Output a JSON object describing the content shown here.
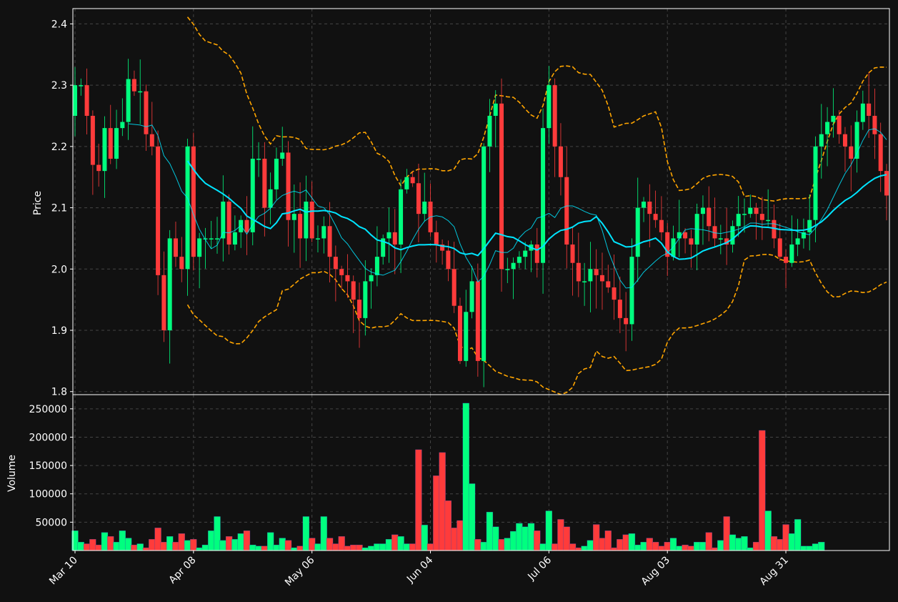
{
  "colors": {
    "background": "#111111",
    "up": "#00ff7f",
    "down": "#ff3b3b",
    "ma_short": "#00e5ff",
    "ma_long": "#00e5ff",
    "bollinger": "#ffa500",
    "grid": "#444444",
    "frame": "#ffffff"
  },
  "chart_data": {
    "type": "candlestick",
    "price_panel": {
      "ylabel": "Price",
      "ylim": [
        1.795,
        2.425
      ],
      "yticks": [
        "1.8",
        "1.9",
        "2.0",
        "2.1",
        "2.2",
        "2.3",
        "2.4"
      ]
    },
    "volume_panel": {
      "ylabel": "Volume",
      "ylim": [
        0,
        275000
      ],
      "yticks": [
        "50000",
        "100000",
        "150000",
        "200000",
        "250000"
      ]
    },
    "x_axis": {
      "tick_labels": [
        "Mar 10",
        "Apr 08",
        "May 06",
        "Jun 04",
        "Jul 06",
        "Aug 03",
        "Aug 31"
      ],
      "tick_indices": [
        0,
        20,
        40,
        60,
        80,
        100,
        120
      ]
    },
    "grid": true,
    "closes": [
      2.3,
      2.3,
      2.25,
      2.17,
      2.16,
      2.23,
      2.18,
      2.23,
      2.24,
      2.31,
      2.29,
      2.29,
      2.22,
      2.2,
      1.99,
      1.9,
      2.05,
      2.02,
      2.0,
      2.2,
      2.02,
      2.05,
      2.05,
      2.05,
      2.05,
      2.11,
      2.04,
      2.06,
      2.08,
      2.06,
      2.18,
      2.18,
      2.1,
      2.13,
      2.18,
      2.19,
      2.08,
      2.09,
      2.05,
      2.11,
      2.05,
      2.05,
      2.07,
      2.02,
      2.0,
      1.99,
      1.98,
      1.95,
      1.92,
      1.98,
      1.99,
      2.02,
      2.05,
      2.06,
      2.04,
      2.13,
      2.15,
      2.14,
      2.09,
      2.11,
      2.06,
      2.04,
      2.03,
      2.0,
      1.94,
      1.85,
      1.93,
      1.98,
      1.85,
      2.2,
      2.25,
      2.27,
      2.0,
      2.0,
      2.01,
      2.02,
      2.03,
      2.04,
      2.01,
      2.23,
      2.3,
      2.2,
      2.15,
      2.04,
      2.01,
      1.98,
      1.98,
      2.0,
      1.99,
      1.98,
      1.97,
      1.95,
      1.92,
      1.91,
      2.02,
      2.1,
      2.11,
      2.09,
      2.08,
      2.06,
      2.02,
      2.05,
      2.06,
      2.05,
      2.04,
      2.09,
      2.1,
      2.07,
      2.05,
      2.05,
      2.04,
      2.07,
      2.09,
      2.09,
      2.1,
      2.09,
      2.08,
      2.08,
      2.05,
      2.02,
      2.01,
      2.04,
      2.05,
      2.06,
      2.08,
      2.2,
      2.22,
      2.24,
      2.25,
      2.22,
      2.2,
      2.18,
      2.24,
      2.27,
      2.25,
      2.22,
      2.16,
      2.12
    ],
    "volumes": [
      35000,
      15000,
      12000,
      20000,
      10000,
      32000,
      25000,
      15000,
      35000,
      22000,
      10000,
      12000,
      5000,
      20000,
      40000,
      15000,
      25000,
      15000,
      30000,
      18000,
      20000,
      5000,
      10000,
      35000,
      60000,
      18000,
      25000,
      20000,
      30000,
      35000,
      10000,
      8000,
      8000,
      32000,
      10000,
      22000,
      18000,
      5000,
      8000,
      60000,
      22000,
      12000,
      60000,
      22000,
      12000,
      25000,
      8000,
      10000,
      10000,
      5000,
      8000,
      12000,
      12000,
      20000,
      28000,
      25000,
      12000,
      12000,
      178000,
      45000,
      12000,
      132000,
      173000,
      88000,
      40000,
      53000,
      260000,
      118000,
      20000,
      15000,
      68000,
      42000,
      20000,
      22000,
      34000,
      48000,
      42000,
      48000,
      35000,
      12000,
      70000,
      12000,
      55000,
      42000,
      12000,
      5000,
      8000,
      18000,
      46000,
      22000,
      35000,
      5000,
      20000,
      28000,
      30000,
      10000,
      15000,
      22000,
      15000,
      8000,
      15000,
      22000,
      8000,
      10000,
      8000,
      15000,
      15000,
      32000,
      5000,
      18000,
      60000,
      28000,
      22000,
      25000,
      5000,
      15000,
      212000,
      70000,
      25000,
      20000,
      46000,
      30000,
      55000,
      8000,
      8000,
      12000,
      15000
    ]
  }
}
